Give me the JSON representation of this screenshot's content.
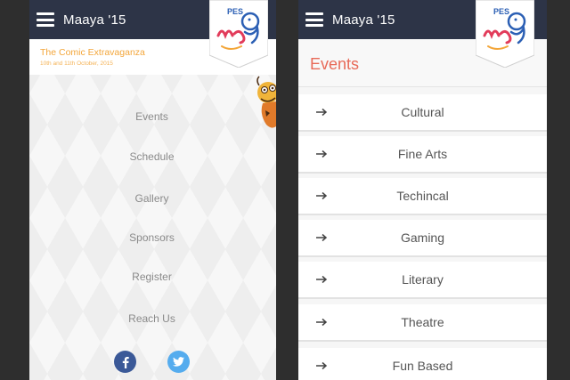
{
  "left_screen": {
    "appbar": {
      "title": "Maaya '15"
    },
    "subheader": {
      "title": "The Comic Extravaganza",
      "date": "10th and 11th October, 2015"
    },
    "menu": [
      {
        "label": "Events"
      },
      {
        "label": "Schedule"
      },
      {
        "label": "Gallery"
      },
      {
        "label": "Sponsors"
      },
      {
        "label": "Register"
      },
      {
        "label": "Reach Us"
      }
    ],
    "social": [
      {
        "icon": "facebook-icon",
        "color": "#3b5998"
      },
      {
        "icon": "twitter-icon",
        "color": "#55acee"
      }
    ]
  },
  "right_screen": {
    "appbar": {
      "title": "Maaya '15"
    },
    "section_title": "Events",
    "events": [
      {
        "label": "Cultural",
        "icon": "arrow-right-icon"
      },
      {
        "label": "Fine Arts",
        "icon": "arrow-right-icon"
      },
      {
        "label": "Techincal",
        "icon": "arrow-right-icon"
      },
      {
        "label": "Gaming",
        "icon": "arrow-right-icon"
      },
      {
        "label": "Literary",
        "icon": "arrow-right-icon"
      },
      {
        "label": "Theatre",
        "icon": "arrow-right-icon"
      },
      {
        "label": "Fun Based",
        "icon": "arrow-right-icon"
      }
    ]
  },
  "logo": {
    "text": "PES"
  },
  "colors": {
    "appbar": "#2d3447",
    "accent_orange": "#f3a63a",
    "events_title": "#e86a58",
    "background": "#2e2e2e"
  }
}
